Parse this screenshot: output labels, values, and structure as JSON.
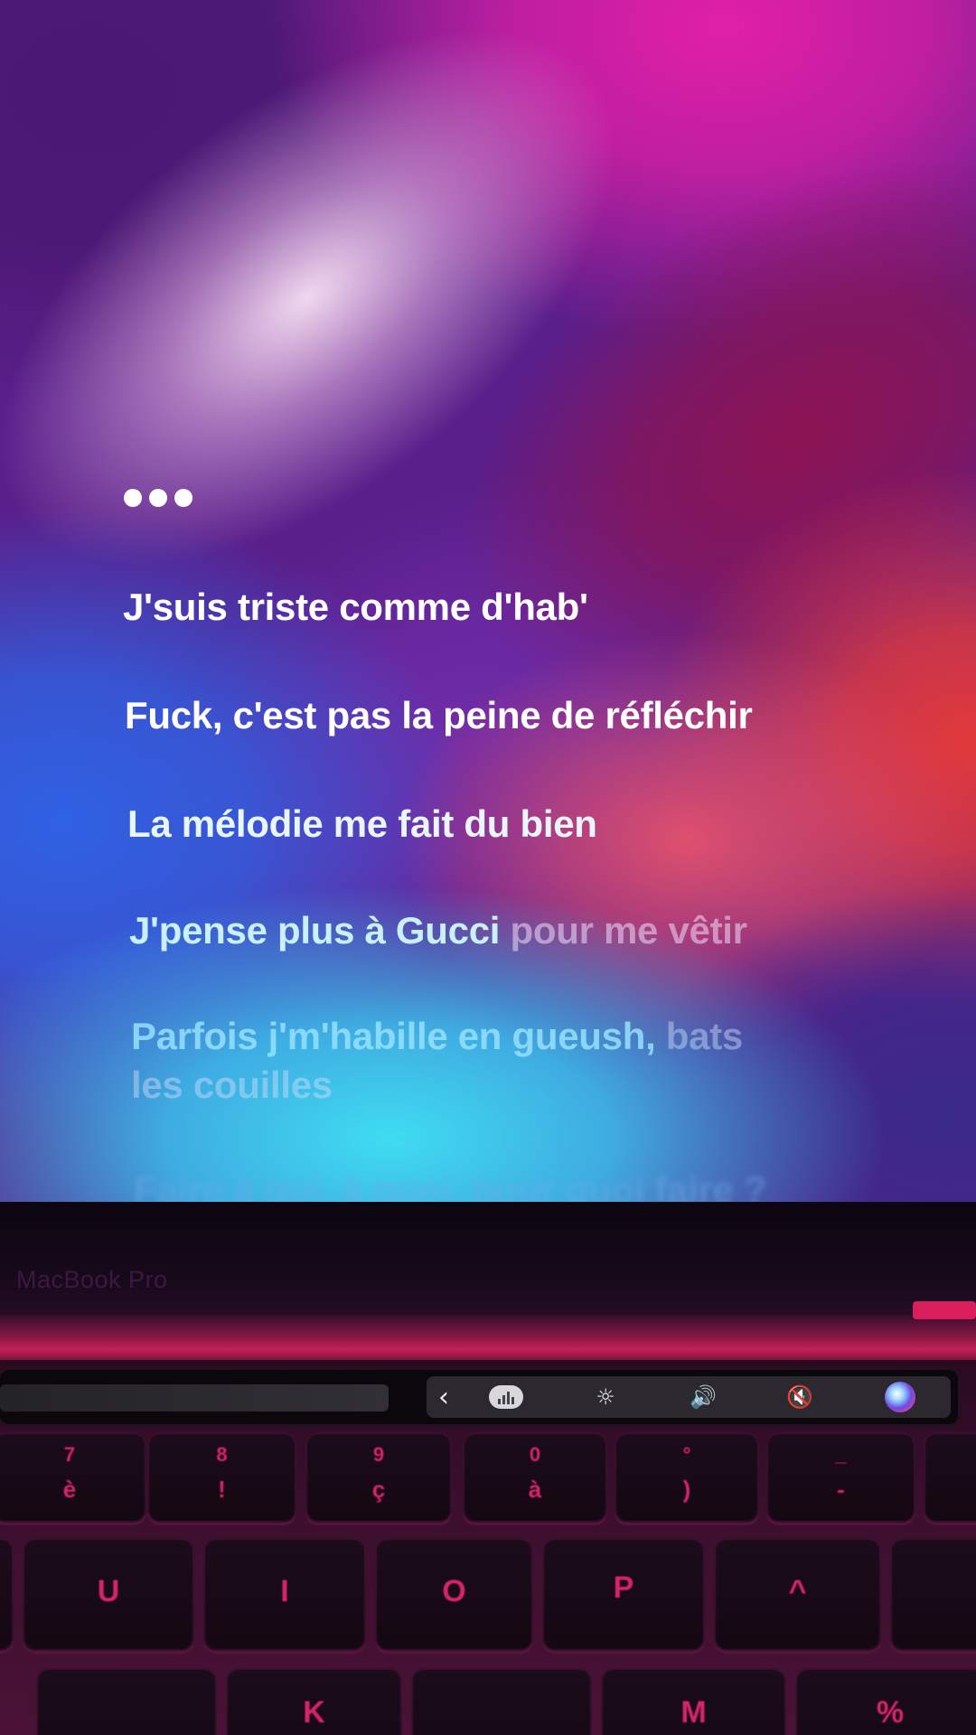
{
  "lyrics": {
    "typing_indicator": "•••",
    "line1": "J'suis triste comme d'hab'",
    "line2": "Fuck, c'est pas la peine de réfléchir",
    "line3": "La mélodie me fait du bien",
    "line4_bright": "J'pense plus à Gucci",
    "line4_dim": " pour me vêtir",
    "line5_bright": "Parfois j'm'habille en gueush,",
    "line5_dim": " bats",
    "line5_cont": "les couilles",
    "line6": "Faire à qui, à quoi, pour quoi faire ?"
  },
  "laptop": {
    "model_label": "MacBook Pro"
  },
  "touch_bar": {
    "back_glyph": "‹",
    "brightness_glyph": "☼",
    "volume_glyph": "🔊",
    "mute_glyph": "🔇",
    "icons": [
      "chevron-left-icon",
      "equalizer-icon",
      "brightness-icon",
      "volume-icon",
      "mute-icon",
      "siri-icon"
    ]
  },
  "keyboard": {
    "number_row": [
      {
        "top": "7",
        "bottom": "è"
      },
      {
        "top": "8",
        "bottom": "!"
      },
      {
        "top": "9",
        "bottom": "ç"
      },
      {
        "top": "0",
        "bottom": "à"
      },
      {
        "top": "°",
        "bottom": ")"
      },
      {
        "top": "_",
        "bottom": "-"
      }
    ],
    "letter_row": [
      "U",
      "I",
      "O",
      "P",
      "^"
    ],
    "bottom_row": [
      "K",
      "M",
      "%"
    ]
  },
  "colors": {
    "key_legend": "#d6246a",
    "lyric_active": "#ffffff"
  }
}
